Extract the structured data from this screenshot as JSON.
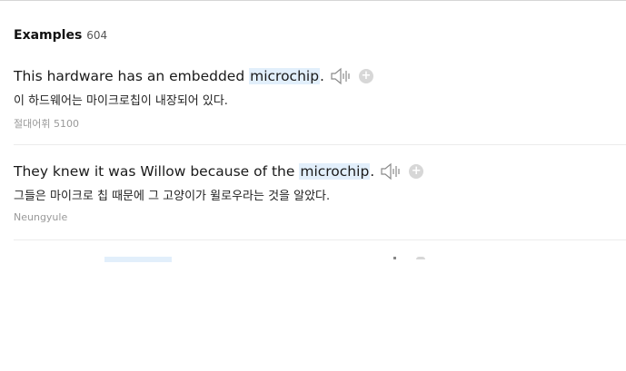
{
  "examples_section": {
    "title": "Examples",
    "count": "604"
  },
  "examples": [
    {
      "pre": "This hardware has an embedded ",
      "keyword": "microchip",
      "post": ".",
      "translation": "이 하드웨어는 마이크로칩이 내장되어 있다.",
      "source": "절대어휘 5100"
    },
    {
      "pre": "They knew it was Willow because of the ",
      "keyword": "microchip",
      "post": ".",
      "translation": "그들은 마이크로 칩 때문에 그 고양이가 윌로우라는 것을 알았다.",
      "source": "Neungyule"
    }
  ],
  "icons": {
    "speaker": "speaker-icon",
    "add": "plus-circle-icon"
  },
  "colors": {
    "highlight": "#e2effb",
    "add_button": "#d7d7d7",
    "source_text": "#999999"
  }
}
